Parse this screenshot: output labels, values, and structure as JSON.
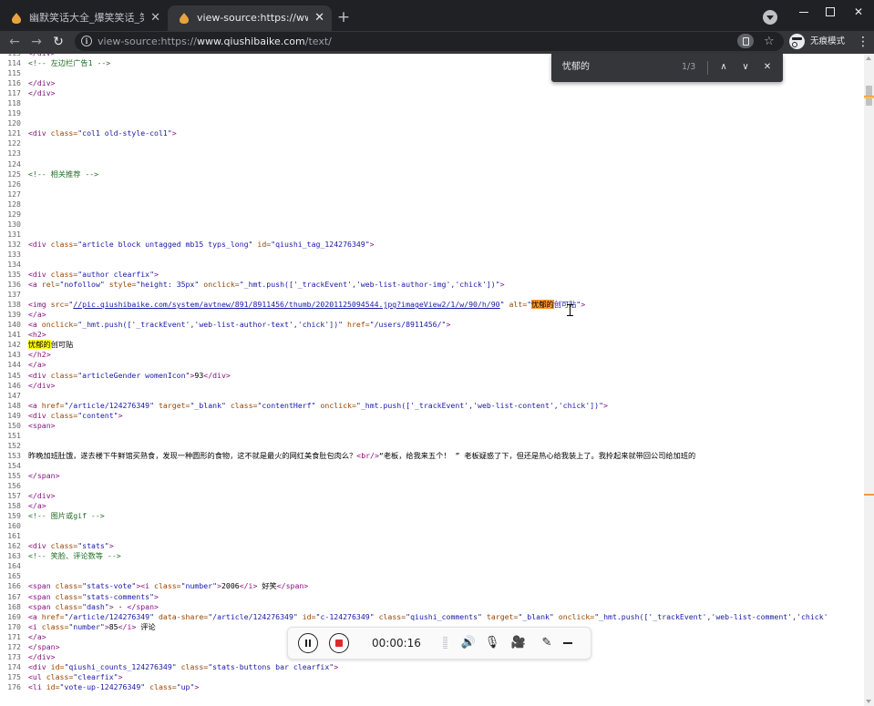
{
  "tabs": [
    {
      "title": "幽默笑话大全_爆笑笑话_笑破你的肚皮",
      "active": false
    },
    {
      "title": "view-source:https://www.qiushibaike.com",
      "active": true
    }
  ],
  "toolbar": {
    "url_prefix": "view-source:https://",
    "url_host": "www.qiushibaike.com",
    "url_path": "/text/",
    "incognito_label": "无痕模式"
  },
  "icons": {
    "back": "←",
    "forward": "→",
    "reload": "↻",
    "star": "☆",
    "kebab": "⋮",
    "tab_close": "✕",
    "new_tab": "+",
    "minimize": "",
    "maximize": "",
    "close": "✕",
    "find_prev": "∧",
    "find_next": "∨",
    "find_close": "✕",
    "speaker": "🔊",
    "mic": "🎙",
    "cam": "🎥",
    "pen": "✎"
  },
  "find": {
    "query": "忧郁的",
    "count": "1/3"
  },
  "recorder": {
    "time": "00:00:16"
  },
  "colors": {
    "tag": "#881280",
    "attr_name": "#994500",
    "attr_value": "#1a1aa6",
    "comment": "#236e25",
    "highlight": "#ffff00",
    "highlight_current": "#ff9632"
  },
  "source_lines": [
    {
      "n": "113",
      "p": [
        {
          "t": "tag",
          "v": "</div>"
        }
      ]
    },
    {
      "n": "114",
      "p": [
        {
          "t": "cm",
          "v": "<!-- 左边栏广告1 -->"
        }
      ]
    },
    {
      "n": "115",
      "p": []
    },
    {
      "n": "116",
      "p": [
        {
          "t": "tag",
          "v": "</div>"
        }
      ]
    },
    {
      "n": "117",
      "p": [
        {
          "t": "tag",
          "v": "</div>"
        }
      ]
    },
    {
      "n": "118",
      "p": []
    },
    {
      "n": "119",
      "p": []
    },
    {
      "n": "120",
      "p": []
    },
    {
      "n": "121",
      "p": [
        {
          "t": "tag",
          "v": "<div "
        },
        {
          "t": "an",
          "v": "class="
        },
        {
          "t": "av",
          "v": "\"col1 old-style-col1\""
        },
        {
          "t": "tag",
          "v": ">"
        }
      ]
    },
    {
      "n": "122",
      "p": []
    },
    {
      "n": "123",
      "p": []
    },
    {
      "n": "124",
      "p": []
    },
    {
      "n": "125",
      "p": [
        {
          "t": "cm",
          "v": "<!-- 相关推荐 -->"
        }
      ]
    },
    {
      "n": "126",
      "p": []
    },
    {
      "n": "127",
      "p": []
    },
    {
      "n": "128",
      "p": []
    },
    {
      "n": "129",
      "p": []
    },
    {
      "n": "130",
      "p": []
    },
    {
      "n": "131",
      "p": []
    },
    {
      "n": "132",
      "p": [
        {
          "t": "tag",
          "v": "<div "
        },
        {
          "t": "an",
          "v": "class="
        },
        {
          "t": "av",
          "v": "\"article block untagged mb15 typs_long\""
        },
        {
          "t": "tag",
          "v": " "
        },
        {
          "t": "an",
          "v": "id="
        },
        {
          "t": "av",
          "v": "\"qiushi_tag_124276349\""
        },
        {
          "t": "tag",
          "v": ">"
        }
      ]
    },
    {
      "n": "133",
      "p": []
    },
    {
      "n": "134",
      "p": []
    },
    {
      "n": "135",
      "p": [
        {
          "t": "tag",
          "v": "<div "
        },
        {
          "t": "an",
          "v": "class="
        },
        {
          "t": "av",
          "v": "\"author clearfix\""
        },
        {
          "t": "tag",
          "v": ">"
        }
      ]
    },
    {
      "n": "136",
      "p": [
        {
          "t": "tag",
          "v": "<a "
        },
        {
          "t": "an",
          "v": "rel="
        },
        {
          "t": "av",
          "v": "\"nofollow\""
        },
        {
          "t": "tag",
          "v": " "
        },
        {
          "t": "an",
          "v": "style="
        },
        {
          "t": "av",
          "v": "\"height: 35px\""
        },
        {
          "t": "tag",
          "v": " "
        },
        {
          "t": "an",
          "v": "onclick="
        },
        {
          "t": "av",
          "v": "\"_hmt.push(['_trackEvent','web-list-author-img','chick'])\""
        },
        {
          "t": "tag",
          "v": ">"
        }
      ]
    },
    {
      "n": "137",
      "p": []
    },
    {
      "n": "138",
      "p": [
        {
          "t": "tag",
          "v": "<img "
        },
        {
          "t": "an",
          "v": "src="
        },
        {
          "t": "av",
          "v": "\""
        },
        {
          "t": "lk",
          "v": "//pic.qiushibaike.com/system/avtnew/891/8911456/thumb/20201125094544.jpg?imageView2/1/w/90/h/90"
        },
        {
          "t": "av",
          "v": "\""
        },
        {
          "t": "tag",
          "v": " "
        },
        {
          "t": "an",
          "v": "alt="
        },
        {
          "t": "av",
          "v": "\""
        },
        {
          "t": "hlc",
          "v": "忧郁的"
        },
        {
          "t": "av",
          "v": "创可贴\""
        },
        {
          "t": "tag",
          "v": ">"
        }
      ]
    },
    {
      "n": "139",
      "p": [
        {
          "t": "tag",
          "v": "</a>"
        }
      ]
    },
    {
      "n": "140",
      "p": [
        {
          "t": "tag",
          "v": "<a "
        },
        {
          "t": "an",
          "v": "onclick="
        },
        {
          "t": "av",
          "v": "\"_hmt.push(['_trackEvent','web-list-author-text','chick'])\""
        },
        {
          "t": "tag",
          "v": " "
        },
        {
          "t": "an",
          "v": "href="
        },
        {
          "t": "av",
          "v": "\"/users/8911456/\""
        },
        {
          "t": "tag",
          "v": ">"
        }
      ]
    },
    {
      "n": "141",
      "p": [
        {
          "t": "tag",
          "v": "<h2>"
        }
      ]
    },
    {
      "n": "142",
      "p": [
        {
          "t": "hl",
          "v": "忧郁的"
        },
        {
          "t": "tx",
          "v": "创可贴"
        }
      ]
    },
    {
      "n": "143",
      "p": [
        {
          "t": "tag",
          "v": "</h2>"
        }
      ]
    },
    {
      "n": "144",
      "p": [
        {
          "t": "tag",
          "v": "</a>"
        }
      ]
    },
    {
      "n": "145",
      "p": [
        {
          "t": "tag",
          "v": "<div "
        },
        {
          "t": "an",
          "v": "class="
        },
        {
          "t": "av",
          "v": "\"articleGender womenIcon\""
        },
        {
          "t": "tag",
          "v": ">"
        },
        {
          "t": "tx",
          "v": "93"
        },
        {
          "t": "tag",
          "v": "</div>"
        }
      ]
    },
    {
      "n": "146",
      "p": [
        {
          "t": "tag",
          "v": "</div>"
        }
      ]
    },
    {
      "n": "147",
      "p": []
    },
    {
      "n": "148",
      "p": [
        {
          "t": "tag",
          "v": "<a "
        },
        {
          "t": "an",
          "v": "href="
        },
        {
          "t": "av",
          "v": "\"/article/124276349\""
        },
        {
          "t": "tag",
          "v": " "
        },
        {
          "t": "an",
          "v": "target="
        },
        {
          "t": "av",
          "v": "\"_blank\""
        },
        {
          "t": "tag",
          "v": " "
        },
        {
          "t": "an",
          "v": "class="
        },
        {
          "t": "av",
          "v": "\"contentHerf\""
        },
        {
          "t": "tag",
          "v": " "
        },
        {
          "t": "an",
          "v": "onclick="
        },
        {
          "t": "av",
          "v": "\"_hmt.push(['_trackEvent','web-list-content','chick'])\""
        },
        {
          "t": "tag",
          "v": ">"
        }
      ]
    },
    {
      "n": "149",
      "p": [
        {
          "t": "tag",
          "v": "<div "
        },
        {
          "t": "an",
          "v": "class="
        },
        {
          "t": "av",
          "v": "\"content\""
        },
        {
          "t": "tag",
          "v": ">"
        }
      ]
    },
    {
      "n": "150",
      "p": [
        {
          "t": "tag",
          "v": "<span>"
        }
      ]
    },
    {
      "n": "151",
      "p": []
    },
    {
      "n": "152",
      "p": []
    },
    {
      "n": "153",
      "p": [
        {
          "t": "tx",
          "v": "昨晚加班肚饿，遂去楼下牛鲜馆买熟食，发现一种圆形的食物，这不就是最火的网红美食肚包肉么？"
        },
        {
          "t": "tag",
          "v": "<br/>"
        },
        {
          "t": "tx",
          "v": "“老板，给我来五个！ ” 老板疑惑了下，但还是热心给我装上了。我拎起来就带回公司给加班的"
        }
      ]
    },
    {
      "n": "154",
      "p": []
    },
    {
      "n": "155",
      "p": [
        {
          "t": "tag",
          "v": "</span>"
        }
      ]
    },
    {
      "n": "156",
      "p": []
    },
    {
      "n": "157",
      "p": [
        {
          "t": "tag",
          "v": "</div>"
        }
      ]
    },
    {
      "n": "158",
      "p": [
        {
          "t": "tag",
          "v": "</a>"
        }
      ]
    },
    {
      "n": "159",
      "p": [
        {
          "t": "cm",
          "v": "<!-- 图片或gif -->"
        }
      ]
    },
    {
      "n": "160",
      "p": []
    },
    {
      "n": "161",
      "p": []
    },
    {
      "n": "162",
      "p": [
        {
          "t": "tag",
          "v": "<div "
        },
        {
          "t": "an",
          "v": "class="
        },
        {
          "t": "av",
          "v": "\"stats\""
        },
        {
          "t": "tag",
          "v": ">"
        }
      ]
    },
    {
      "n": "163",
      "p": [
        {
          "t": "cm",
          "v": "<!-- 笑脸、评论数等 -->"
        }
      ]
    },
    {
      "n": "164",
      "p": []
    },
    {
      "n": "165",
      "p": []
    },
    {
      "n": "166",
      "p": [
        {
          "t": "tag",
          "v": "<span "
        },
        {
          "t": "an",
          "v": "class="
        },
        {
          "t": "av",
          "v": "\"stats-vote\""
        },
        {
          "t": "tag",
          "v": "><i "
        },
        {
          "t": "an",
          "v": "class="
        },
        {
          "t": "av",
          "v": "\"number\""
        },
        {
          "t": "tag",
          "v": ">"
        },
        {
          "t": "tx",
          "v": "2006"
        },
        {
          "t": "tag",
          "v": "</i>"
        },
        {
          "t": "tx",
          "v": " 好笑"
        },
        {
          "t": "tag",
          "v": "</span>"
        }
      ]
    },
    {
      "n": "167",
      "p": [
        {
          "t": "tag",
          "v": "<span "
        },
        {
          "t": "an",
          "v": "class="
        },
        {
          "t": "av",
          "v": "\"stats-comments\""
        },
        {
          "t": "tag",
          "v": ">"
        }
      ]
    },
    {
      "n": "168",
      "p": [
        {
          "t": "tag",
          "v": "<span "
        },
        {
          "t": "an",
          "v": "class="
        },
        {
          "t": "av",
          "v": "\"dash\""
        },
        {
          "t": "tag",
          "v": ">"
        },
        {
          "t": "tx",
          "v": " · "
        },
        {
          "t": "tag",
          "v": "</span>"
        }
      ]
    },
    {
      "n": "169",
      "p": [
        {
          "t": "tag",
          "v": "<a "
        },
        {
          "t": "an",
          "v": "href="
        },
        {
          "t": "av",
          "v": "\"/article/124276349\""
        },
        {
          "t": "tag",
          "v": " "
        },
        {
          "t": "an",
          "v": "data-share="
        },
        {
          "t": "av",
          "v": "\"/article/124276349\""
        },
        {
          "t": "tag",
          "v": " "
        },
        {
          "t": "an",
          "v": "id="
        },
        {
          "t": "av",
          "v": "\"c-124276349\""
        },
        {
          "t": "tag",
          "v": " "
        },
        {
          "t": "an",
          "v": "class="
        },
        {
          "t": "av",
          "v": "\"qiushi_comments\""
        },
        {
          "t": "tag",
          "v": " "
        },
        {
          "t": "an",
          "v": "target="
        },
        {
          "t": "av",
          "v": "\"_blank\""
        },
        {
          "t": "tag",
          "v": " "
        },
        {
          "t": "an",
          "v": "onclick="
        },
        {
          "t": "av",
          "v": "\"_hmt.push(['_trackEvent','web-list-comment','chick'"
        }
      ]
    },
    {
      "n": "170",
      "p": [
        {
          "t": "tag",
          "v": "<i "
        },
        {
          "t": "an",
          "v": "class="
        },
        {
          "t": "av",
          "v": "\"number\""
        },
        {
          "t": "tag",
          "v": ">"
        },
        {
          "t": "tx",
          "v": "85"
        },
        {
          "t": "tag",
          "v": "</i>"
        },
        {
          "t": "tx",
          "v": " 评论"
        }
      ]
    },
    {
      "n": "171",
      "p": [
        {
          "t": "tag",
          "v": "</a>"
        }
      ]
    },
    {
      "n": "172",
      "p": [
        {
          "t": "tag",
          "v": "</span>"
        }
      ]
    },
    {
      "n": "173",
      "p": [
        {
          "t": "tag",
          "v": "</div>"
        }
      ]
    },
    {
      "n": "174",
      "p": [
        {
          "t": "tag",
          "v": "<div "
        },
        {
          "t": "an",
          "v": "id="
        },
        {
          "t": "av",
          "v": "\"qiushi_counts_124276349\""
        },
        {
          "t": "tag",
          "v": " "
        },
        {
          "t": "an",
          "v": "class="
        },
        {
          "t": "av",
          "v": "\"stats-buttons bar clearfix\""
        },
        {
          "t": "tag",
          "v": ">"
        }
      ]
    },
    {
      "n": "175",
      "p": [
        {
          "t": "tag",
          "v": "<ul "
        },
        {
          "t": "an",
          "v": "class="
        },
        {
          "t": "av",
          "v": "\"clearfix\""
        },
        {
          "t": "tag",
          "v": ">"
        }
      ]
    },
    {
      "n": "176",
      "p": [
        {
          "t": "tag",
          "v": "<li "
        },
        {
          "t": "an",
          "v": "id="
        },
        {
          "t": "av",
          "v": "\"vote-up-124276349\""
        },
        {
          "t": "tag",
          "v": " "
        },
        {
          "t": "an",
          "v": "class="
        },
        {
          "t": "av",
          "v": "\"up\""
        },
        {
          "t": "tag",
          "v": ">"
        }
      ]
    }
  ]
}
